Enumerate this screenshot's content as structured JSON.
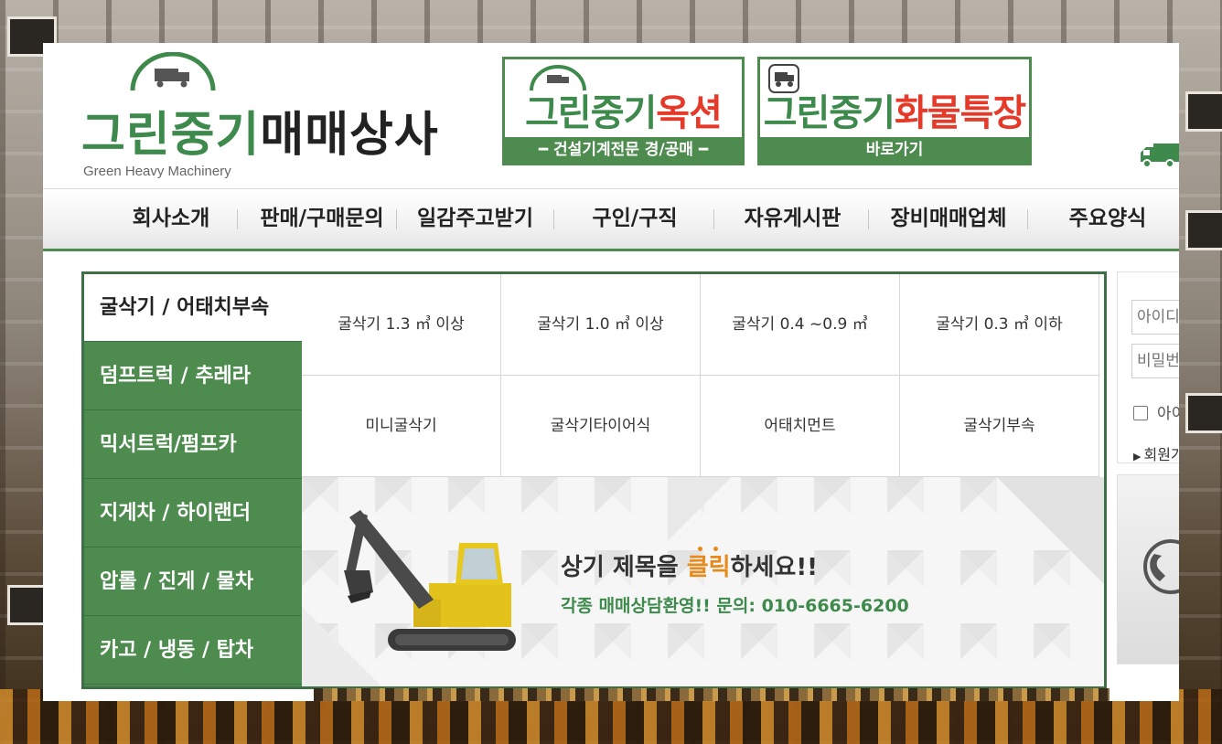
{
  "logo": {
    "main_green": "그린중기",
    "main_dark": "매매상사",
    "sub": "Green Heavy Machinery"
  },
  "banners": {
    "auction": {
      "title_green": "그린중기",
      "title_red": "옥션",
      "strip": "━  건설기계전문 경/공매  ━"
    },
    "cargo": {
      "title_green": "그린중기",
      "title_red": "화물특장",
      "strip": "바로가기"
    }
  },
  "nav": {
    "items": [
      "회사소개",
      "판매/구매문의",
      "일감주고받기",
      "구인/구직",
      "자유게시판",
      "장비매매업체",
      "주요양식"
    ]
  },
  "sidebar": {
    "items": [
      {
        "label": "굴삭기 / 어태치부속",
        "active": true
      },
      {
        "label": "덤프트럭 / 추레라"
      },
      {
        "label": "믹서트럭/펌프카"
      },
      {
        "label": "지게차 / 하이랜더"
      },
      {
        "label": "압롤 / 진게 / 물차"
      },
      {
        "label": "카고 / 냉동 / 탑차"
      }
    ]
  },
  "subcategories": [
    "굴삭기 1.3 ㎥ 이상",
    "굴삭기 1.0 ㎥ 이상",
    "굴삭기 0.4 ~0.9 ㎥",
    "굴삭기 0.3 ㎥ 이하",
    "미니굴삭기",
    "굴삭기타이어식",
    "어태치먼트",
    "굴삭기부속"
  ],
  "promo": {
    "title_pre": "상기 제목을 ",
    "title_hl": "클릭",
    "title_post": "하세요!!",
    "sub": "각종 매매상담환영!! 문의: 010-6665-6200"
  },
  "login": {
    "id_placeholder": "아이디",
    "pw_placeholder": "비밀번호",
    "remember": "아이디 저장",
    "join": "회원가입"
  },
  "colors": {
    "brand_green": "#4d8b4e",
    "accent_red": "#e53a2a",
    "accent_orange": "#e88a1a"
  }
}
